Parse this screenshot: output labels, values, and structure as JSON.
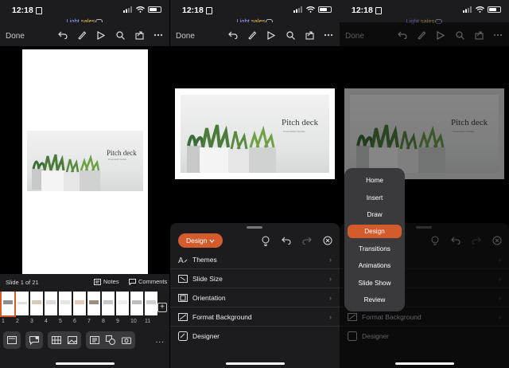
{
  "status": {
    "time": "12:18"
  },
  "app": {
    "title_a": "Light",
    "title_b": "sales"
  },
  "toolbar": {
    "done": "Done"
  },
  "slide": {
    "title": "Pitch deck",
    "subtitle": "Presentation Subtitle"
  },
  "panel1": {
    "slide_info": "Slide 1 of 21",
    "notes": "Notes",
    "comments": "Comments",
    "thumb_numbers": [
      "1",
      "2",
      "3",
      "4",
      "5",
      "6",
      "7",
      "8",
      "9",
      "10",
      "11"
    ],
    "more": "..."
  },
  "panel2": {
    "tab_label": "Design",
    "items": [
      {
        "label": "Themes",
        "icon": "themes-icon"
      },
      {
        "label": "Slide Size",
        "icon": "slide-size-icon"
      },
      {
        "label": "Orientation",
        "icon": "orientation-icon"
      },
      {
        "label": "Format Background",
        "icon": "format-background-icon"
      },
      {
        "label": "Designer",
        "icon": "designer-icon"
      }
    ]
  },
  "panel3": {
    "menu": [
      "Home",
      "Insert",
      "Draw",
      "Design",
      "Transitions",
      "Animations",
      "Slide Show",
      "Review"
    ],
    "active": "Design",
    "visible_items": [
      {
        "label": "Format Background"
      },
      {
        "label": "Designer"
      }
    ]
  },
  "colors": {
    "accent": "#d35b2c",
    "panel": "#1c1c1e",
    "menu_bg": "#3a3a3c"
  }
}
